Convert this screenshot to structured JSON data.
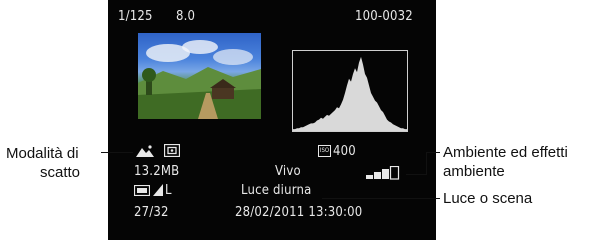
{
  "lcd": {
    "shutter_speed": "1/125",
    "aperture": "8.0",
    "file_number": "100-0032",
    "iso": "400",
    "iso_label": "ISO",
    "file_size": "13.2MB",
    "picture_style": "Vivo",
    "light_scene": "Luce diurna",
    "image_counter": "27/32",
    "datetime": "28/02/2011 13:30:00",
    "quality_label": "L",
    "mode_icon": "landscape-icon",
    "metering_icon": "evaluative-metering-icon",
    "colors": {
      "screen": "#050505",
      "text": "#e8e8e8"
    }
  },
  "callouts": {
    "shooting_mode": {
      "line1": "Modalità di",
      "line2": "scatto"
    },
    "ambience": {
      "line1": "Ambiente ed effetti",
      "line2": "ambiente"
    },
    "light_scene": {
      "label": "Luce o scena"
    }
  },
  "histogram": {
    "levels": [
      2,
      2,
      3,
      3,
      4,
      4,
      5,
      6,
      7,
      8,
      8,
      9,
      11,
      12,
      14,
      13,
      15,
      17,
      16,
      18,
      20,
      22,
      25,
      24,
      28,
      33,
      40,
      48,
      55,
      52,
      60,
      66,
      62,
      72,
      78,
      70,
      60,
      56,
      48,
      40,
      36,
      32,
      30,
      26,
      22,
      20,
      16,
      12,
      10,
      9,
      7,
      6,
      5,
      4,
      3,
      3,
      2,
      2
    ]
  }
}
